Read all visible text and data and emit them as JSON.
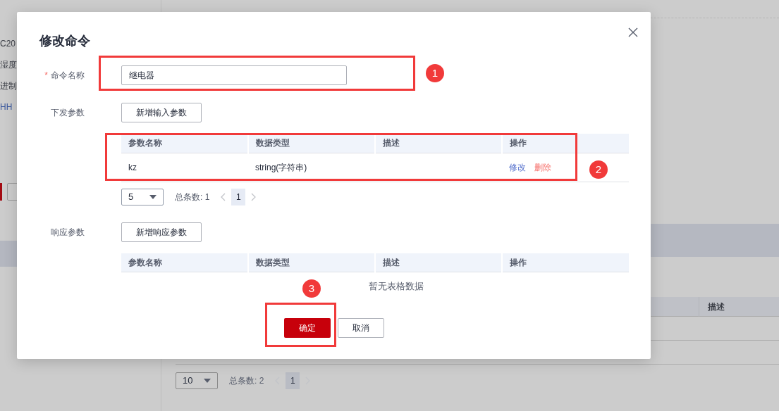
{
  "background": {
    "side_texts": [
      {
        "text": "C20",
        "kind": "plain"
      },
      {
        "text": "湿度",
        "kind": "plain"
      },
      {
        "text": "进制",
        "kind": "plain"
      },
      {
        "text": "HH",
        "kind": "link"
      }
    ],
    "table_columns": [
      "描述"
    ],
    "pagination": {
      "page_size": "10",
      "total": "总条数: 2",
      "pages": [
        {
          "label": "1",
          "selected": true
        }
      ]
    }
  },
  "dialog": {
    "title": "修改命令",
    "fields": [
      {
        "label": "命令名称",
        "required_mark": "*",
        "kind": "input",
        "value": "继电器"
      },
      {
        "label": "下发参数",
        "kind": "table",
        "add_button": "新增输入参数",
        "columns": [
          "参数名称",
          "数据类型",
          "描述",
          "操作"
        ],
        "rows": [
          {
            "name": "kz",
            "type": "string(字符串)",
            "actions": [
              {
                "label": "修改",
                "kind": "edit"
              },
              {
                "label": "删除",
                "kind": "delete"
              }
            ]
          }
        ],
        "pagination": {
          "page_size": "5",
          "total": "总条数: 1",
          "pages": [
            {
              "label": "1",
              "selected": true
            }
          ]
        }
      },
      {
        "label": "响应参数",
        "kind": "table",
        "add_button": "新增响应参数",
        "columns": [
          "参数名称",
          "数据类型",
          "描述",
          "操作"
        ],
        "empty_text": "暂无表格数据"
      }
    ],
    "buttons": [
      {
        "label": "确定",
        "kind": "primary"
      },
      {
        "label": "取消",
        "kind": "default"
      }
    ]
  },
  "annotations": [
    {
      "label": "1"
    },
    {
      "label": "2"
    },
    {
      "label": "3"
    }
  ]
}
